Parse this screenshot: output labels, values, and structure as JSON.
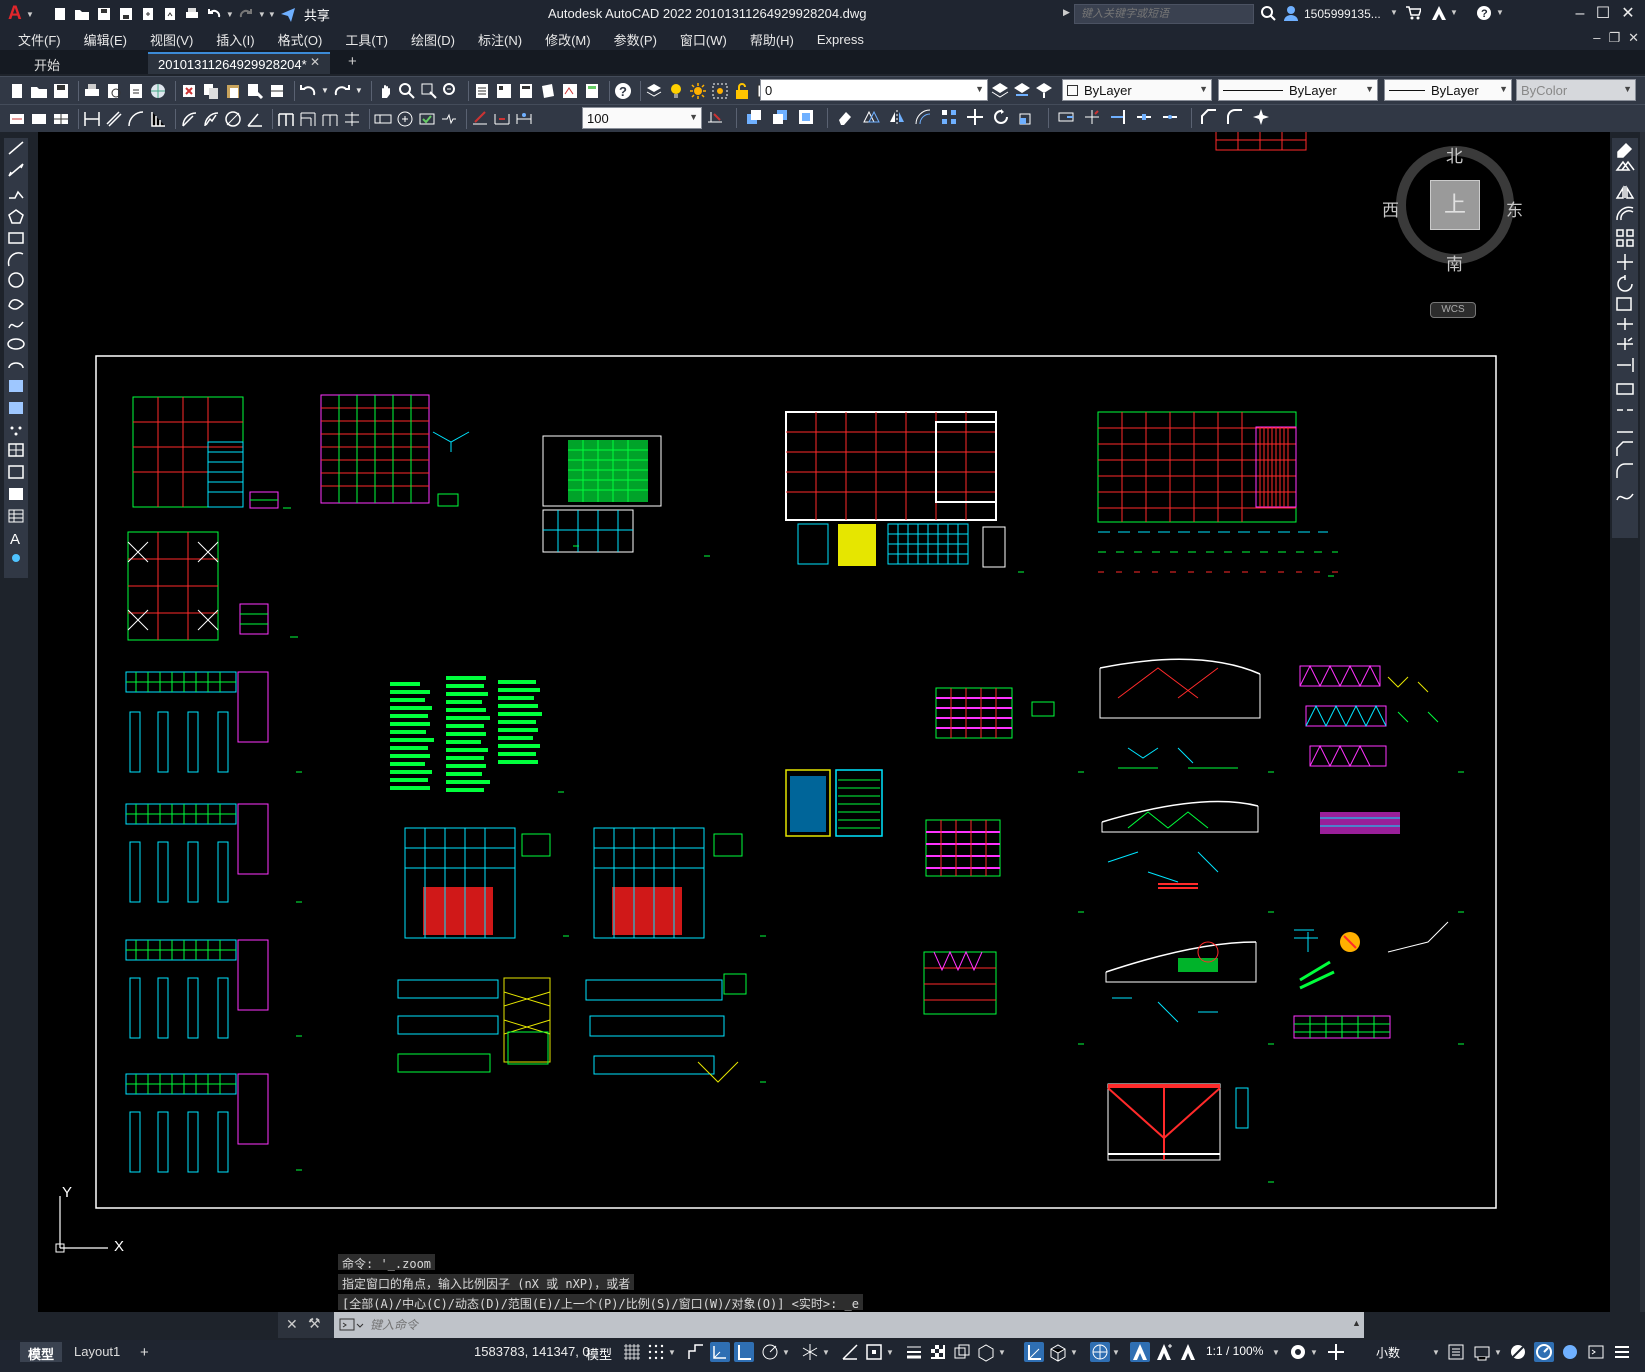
{
  "app": {
    "window_title": "Autodesk AutoCAD 2022   20101311264929928204.dwg",
    "logo": "A",
    "share_label": "共享",
    "search_placeholder": "键入关键字或短语",
    "user_name": "1505999135...",
    "window_controls": [
      "minimize",
      "maximize",
      "close"
    ]
  },
  "menu": [
    "文件(F)",
    "编辑(E)",
    "视图(V)",
    "插入(I)",
    "格式(O)",
    "工具(T)",
    "绘图(D)",
    "标注(N)",
    "修改(M)",
    "参数(P)",
    "窗口(W)",
    "帮助(H)",
    "Express"
  ],
  "tabs": {
    "start": "开始",
    "drawing": "20101311264929928204*",
    "add": "+"
  },
  "toolbar": {
    "layer_value": "0",
    "color_value": "ByLayer",
    "linetype_value": "ByLayer",
    "lineweight_value": "ByLayer",
    "plotstyle_value": "ByColor",
    "dimscale_value": "100"
  },
  "viewcube": {
    "north": "北",
    "south": "南",
    "east": "东",
    "west": "西",
    "face": "上",
    "wcs": "WCS"
  },
  "ucs": {
    "x_label": "X",
    "y_label": "Y"
  },
  "command": {
    "history": [
      "命令: '_.zoom",
      "指定窗口的角点，输入比例因子 (nX 或 nXP)，或者",
      "[全部(A)/中心(C)/动态(D)/范围(E)/上一个(P)/比例(S)/窗口(W)/对象(O)] <实时>: _e"
    ],
    "placeholder": "键入命令"
  },
  "status": {
    "model_tab": "模型",
    "layout_tab": "Layout1",
    "add_tab": "+",
    "coordinates": "1583783, 141347, 0",
    "space": "模型",
    "annotation_scale": "1:1 / 100%",
    "units": "小数"
  },
  "colors": {
    "titlebar": "#1f2530",
    "canvas": "#000000",
    "accent": "#3c8bd6",
    "drawing_red": "#ff2a2a",
    "drawing_green": "#00ff3c",
    "drawing_cyan": "#00e5ff",
    "drawing_yellow": "#ffff00",
    "drawing_magenta": "#ff33ff"
  }
}
